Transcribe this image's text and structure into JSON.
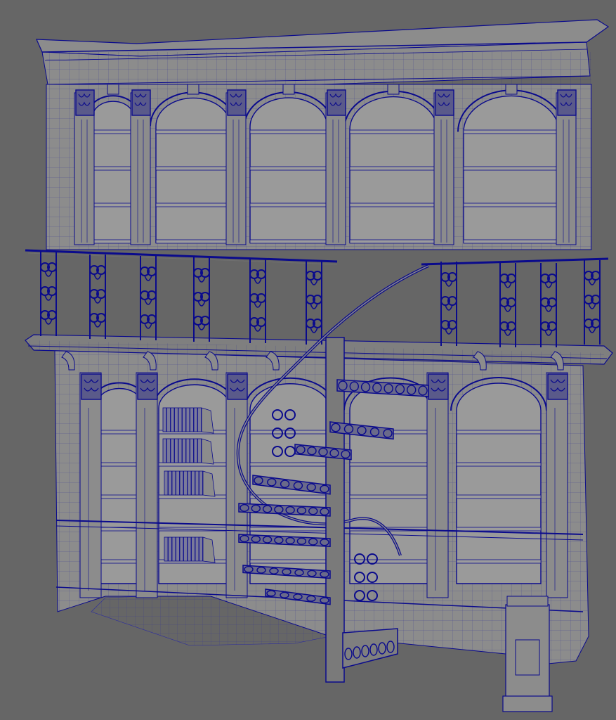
{
  "viewport": {
    "title": "",
    "background": "#666666",
    "model_fill": "#8c8c8c",
    "model_fill_dark": "#6f6f6f",
    "shelf_back": "#9a9a9a",
    "wire_color": "#0a0a8c",
    "wire_light": "#3030b0"
  },
  "model": {
    "name": "",
    "upper_bays": 5,
    "lower_bays": 5,
    "shelves_per_bay": 4,
    "staircase": "spiral"
  }
}
